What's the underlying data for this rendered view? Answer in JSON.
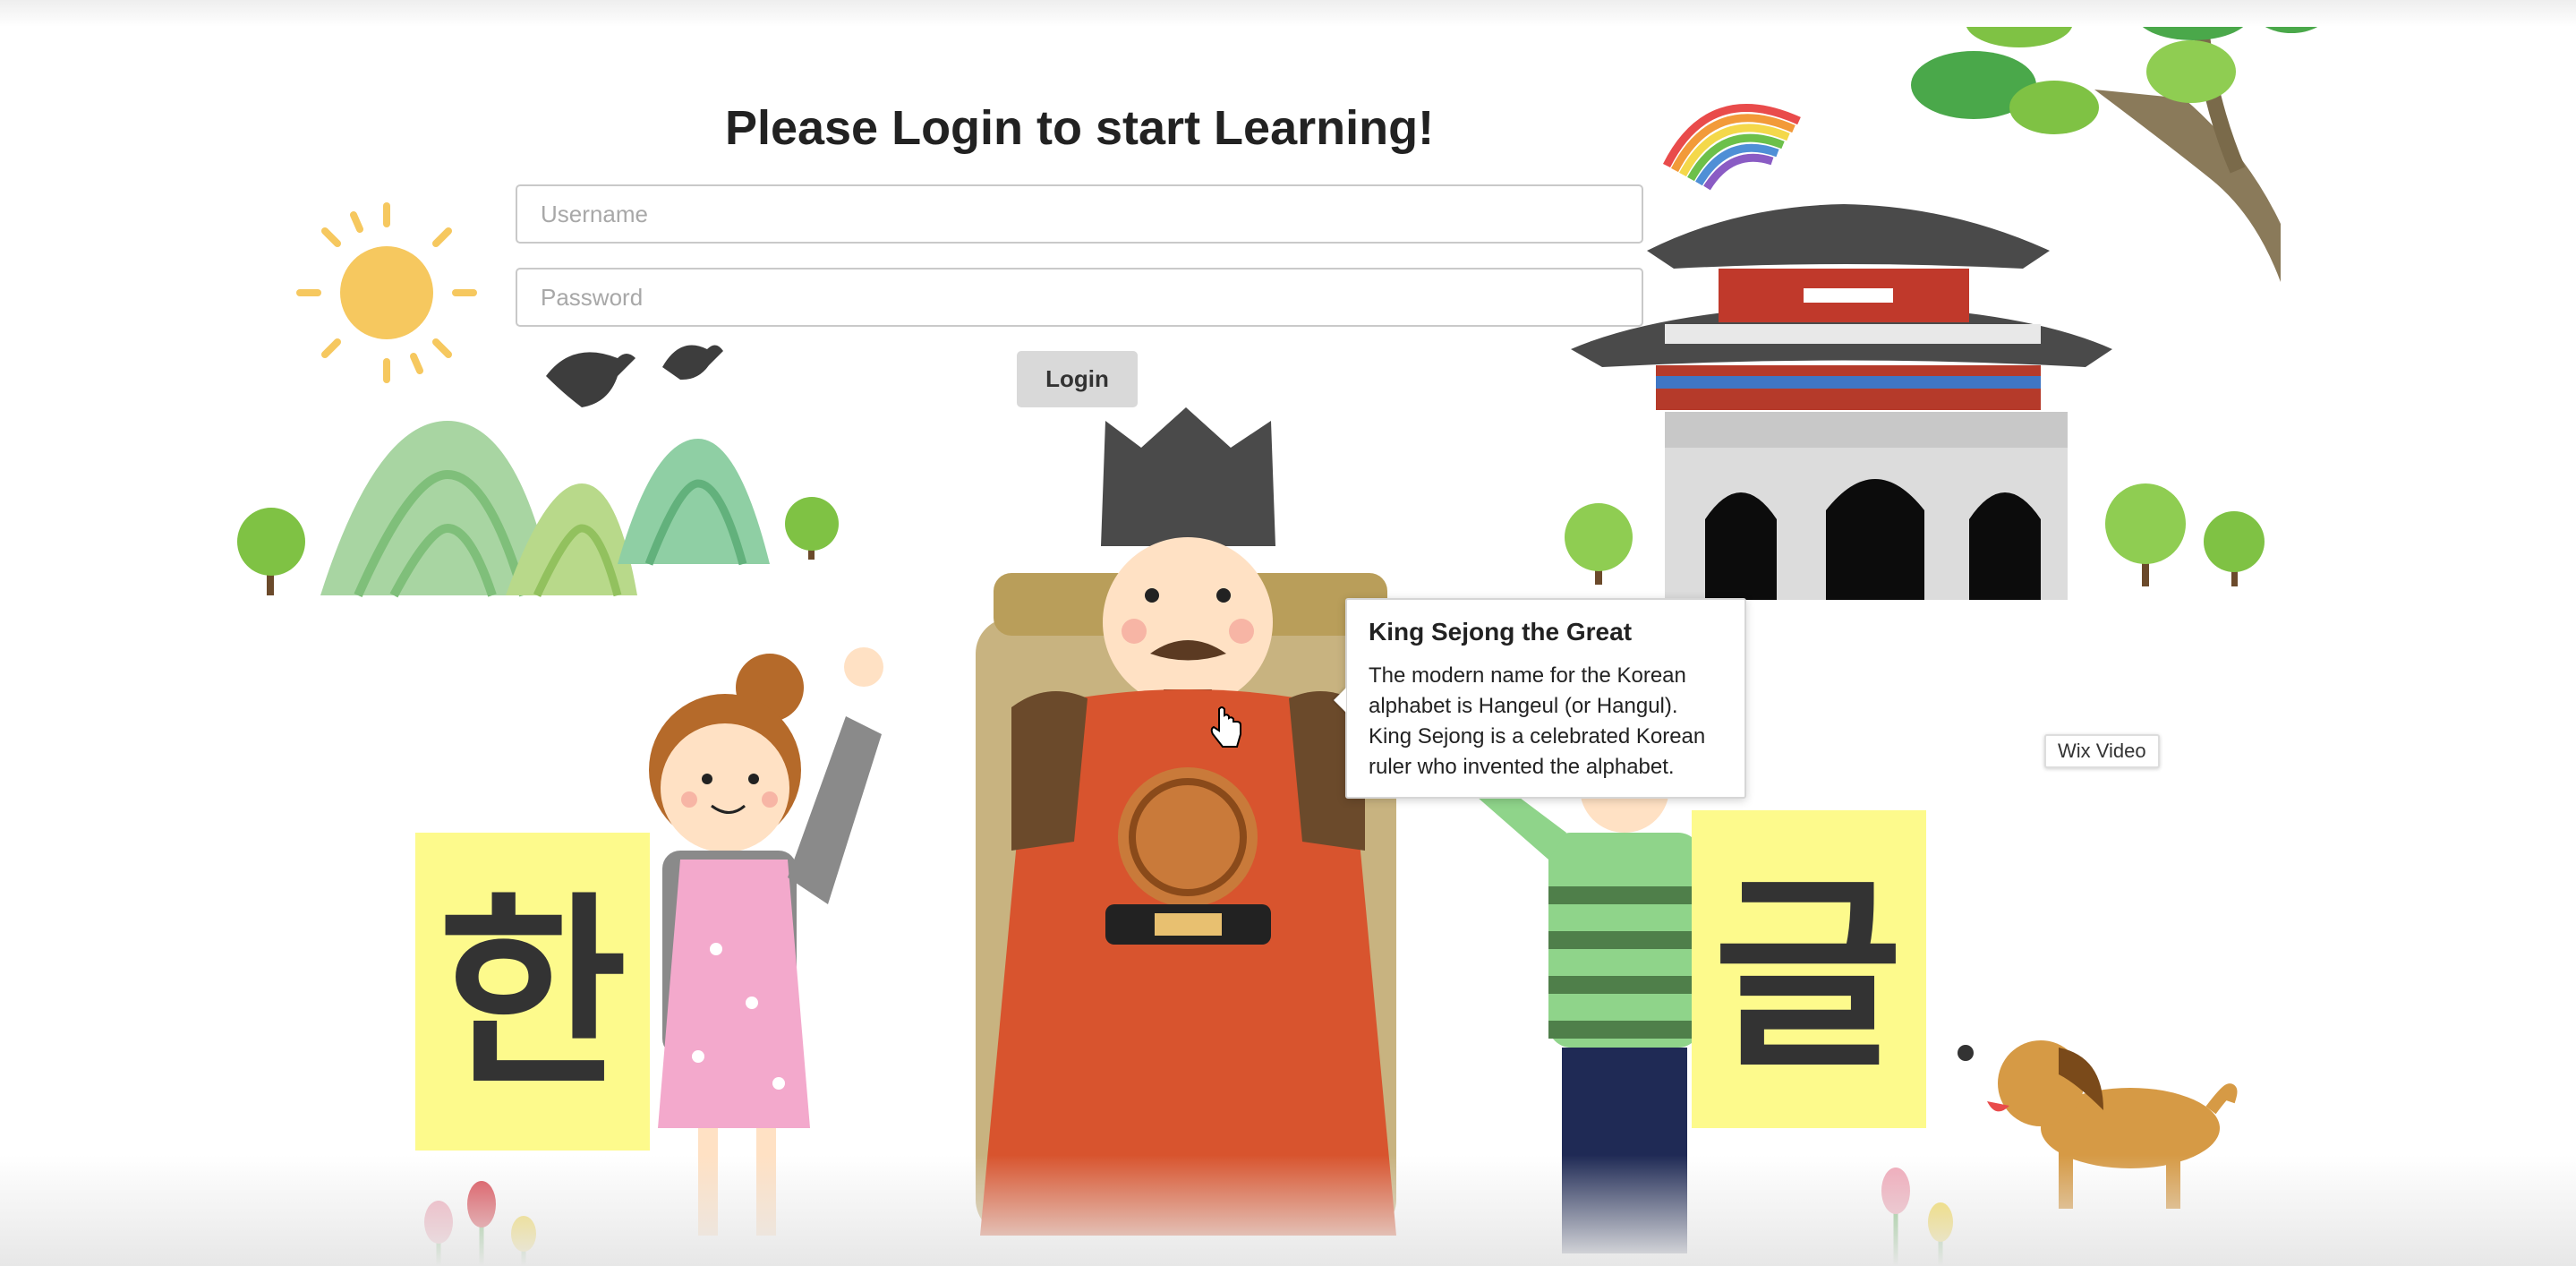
{
  "login": {
    "title": "Please Login to start Learning!",
    "username_placeholder": "Username",
    "password_placeholder": "Password",
    "button_label": "Login"
  },
  "tooltip": {
    "title": "King Sejong the Great",
    "body": "The modern name for the Korean alphabet is Hangeul (or Hangul). King Sejong is a celebrated Korean ruler who invented the alphabet."
  },
  "illustration": {
    "left_sign_text": "한",
    "right_sign_text": "글"
  },
  "badge": {
    "label": "Wix Video"
  },
  "icons": {
    "cursor": "hand-pointer-icon"
  },
  "colors": {
    "king_robe": "#d8542e",
    "sign_yellow": "#fdfa8c",
    "palace_roof": "#4a4a4a",
    "tree_green": "#7fc244"
  }
}
